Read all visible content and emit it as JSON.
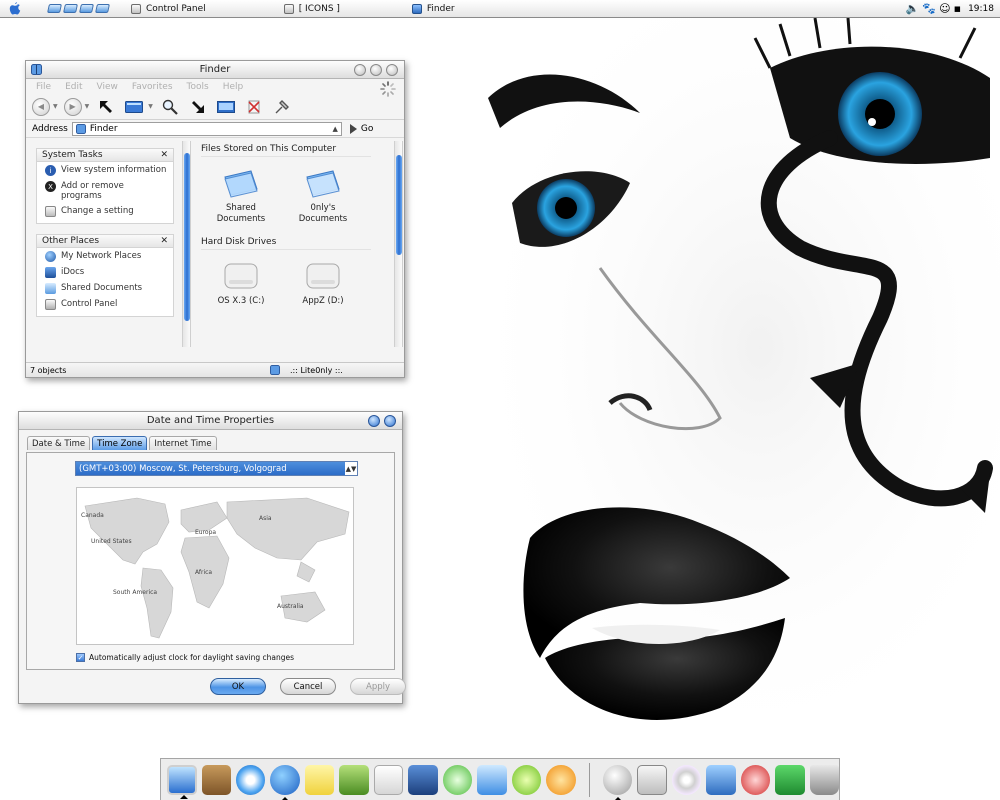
{
  "menubar": {
    "taskbar": [
      {
        "label": "Control Panel"
      },
      {
        "label": "[ ICONS ]"
      },
      {
        "label": "Finder"
      }
    ],
    "clock": "19:18"
  },
  "finder": {
    "title": "Finder",
    "menu": [
      "File",
      "Edit",
      "View",
      "Favorites",
      "Tools",
      "Help"
    ],
    "address_label": "Address",
    "address_value": "Finder",
    "go_label": "Go",
    "system_tasks": {
      "title": "System Tasks",
      "items": [
        "View system information",
        "Add or remove programs",
        "Change a setting"
      ]
    },
    "other_places": {
      "title": "Other Places",
      "items": [
        "My Network Places",
        "iDocs",
        "Shared Documents",
        "Control Panel"
      ]
    },
    "groups": [
      {
        "title": "Files Stored on This Computer",
        "items": [
          "Shared Documents",
          "0nly's Documents"
        ]
      },
      {
        "title": "Hard Disk Drives",
        "items": [
          "OS X.3 (C:)",
          "AppZ (D:)"
        ]
      }
    ],
    "status_left": "7 objects",
    "status_right": ".:: Lite0nly ::."
  },
  "datetime": {
    "title": "Date and Time Properties",
    "tabs": [
      "Date & Time",
      "Time Zone",
      "Internet Time"
    ],
    "active_tab": "Time Zone",
    "timezone": "(GMT+03:00) Moscow, St. Petersburg, Volgograd",
    "map_labels": [
      "Canada",
      "United States",
      "Europa",
      "Asia",
      "Africa",
      "South America",
      "Australia"
    ],
    "daylight_label": "Automatically adjust clock for daylight saving changes",
    "daylight_checked": true,
    "buttons": {
      "ok": "OK",
      "cancel": "Cancel",
      "apply": "Apply"
    }
  },
  "dock": {
    "items": [
      "finder-monitor",
      "address-book",
      "safari",
      "ichat",
      "stickies",
      "iphoto",
      "textedit",
      "imovie",
      "itunes",
      "mail",
      "hi-chat",
      "ical-download",
      "at-mail",
      "disk-drive",
      "cd-player",
      "command",
      "heart-app",
      "path-finder",
      "trash"
    ]
  },
  "colors": {
    "accent": "#2c6ed0",
    "iris": "#1e8fd6"
  }
}
